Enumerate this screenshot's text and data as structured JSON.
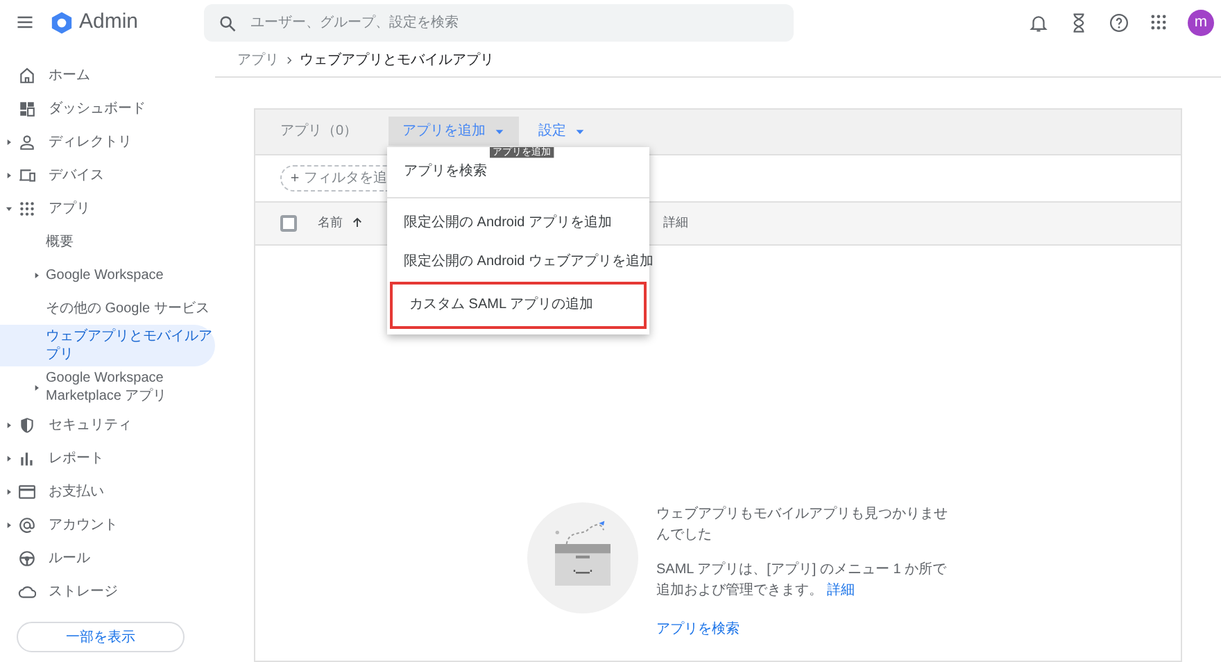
{
  "header": {
    "product": "Admin",
    "search": {
      "placeholder": "ユーザー、グループ、設定を検索"
    },
    "avatar": "m"
  },
  "sidebar": {
    "items": [
      {
        "label": "ホーム",
        "selected": false
      },
      {
        "label": "ダッシュボード",
        "selected": false
      },
      {
        "label": "ディレクトリ",
        "selected": false,
        "expanded": false
      },
      {
        "label": "デバイス",
        "selected": false,
        "expanded": false
      },
      {
        "label": "アプリ",
        "selected": false,
        "expanded": true,
        "children": [
          {
            "label": "概要",
            "selected": false
          },
          {
            "label": "Google Workspace",
            "selected": false,
            "expanded": false
          },
          {
            "label": "その他の Google サービス",
            "selected": false
          },
          {
            "label": "ウェブアプリとモバイルアプリ",
            "selected": true
          },
          {
            "label": "Google Workspace Marketplace アプリ",
            "selected": false,
            "expanded": false
          }
        ]
      },
      {
        "label": "セキュリティ",
        "selected": false,
        "expanded": false
      },
      {
        "label": "レポート",
        "selected": false,
        "expanded": false
      },
      {
        "label": "お支払い",
        "selected": false,
        "expanded": false
      },
      {
        "label": "アカウント",
        "selected": false,
        "expanded": false
      },
      {
        "label": "ルール",
        "selected": false
      },
      {
        "label": "ストレージ",
        "selected": false
      }
    ],
    "show_less_button": "一部を表示"
  },
  "breadcrumb": [
    "アプリ",
    "ウェブアプリとモバイルアプリ"
  ],
  "card": {
    "title": "アプリ（0）",
    "actions": [
      {
        "label": "アプリを追加",
        "pressed": true
      },
      {
        "label": "設定",
        "pressed": false
      }
    ],
    "tooltip": "アプリを追加",
    "filter_button": "フィルタを追",
    "select_all": {
      "checked": false
    },
    "columns": [
      "名前",
      "詳細"
    ],
    "menu": {
      "sections": [
        [
          {
            "label": "アプリを検索",
            "highlighted": false
          }
        ],
        [
          {
            "label": "限定公開の Android アプリを追加",
            "highlighted": false
          },
          {
            "label": "限定公開の Android ウェブアプリを追加",
            "highlighted": false
          },
          {
            "label": "カスタム SAML アプリの追加",
            "highlighted": true
          }
        ]
      ]
    },
    "empty_state": {
      "title": "ウェブアプリもモバイルアプリも見つかりませんでした",
      "description": "SAML アプリは、[アプリ] のメニュー 1 か所で追加および管理できます。",
      "link": "詳細",
      "action": "アプリを検索"
    }
  }
}
